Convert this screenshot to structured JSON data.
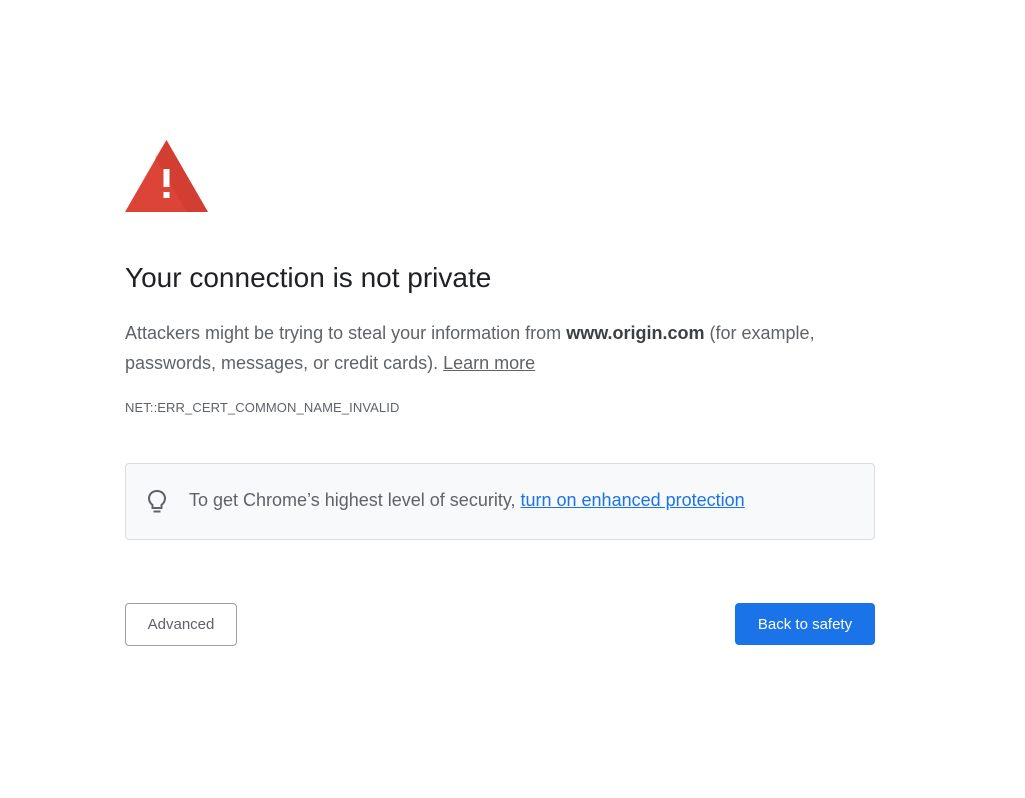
{
  "page": {
    "title": "Your connection is not private",
    "description_prefix": "Attackers might be trying to steal your information from ",
    "domain": "www.origin.com",
    "description_suffix": " (for example, passwords, messages, or credit cards). ",
    "learn_more": "Learn more",
    "error_code": "NET::ERR_CERT_COMMON_NAME_INVALID"
  },
  "tip": {
    "text": "To get Chrome’s highest level of security, ",
    "link": "turn on enhanced protection",
    "icon": "lightbulb-icon"
  },
  "buttons": {
    "advanced": "Advanced",
    "back_to_safety": "Back to safety"
  },
  "icons": {
    "warning": "warning-triangle-icon"
  },
  "colors": {
    "warning_red": "#db4437",
    "primary_blue": "#1a73e8",
    "text_grey": "#5f6368",
    "title_dark": "#202124",
    "tip_background": "#f8f9fa"
  }
}
